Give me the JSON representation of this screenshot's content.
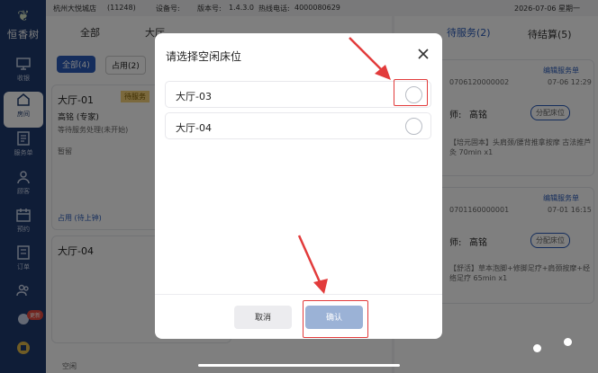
{
  "app": {
    "logo_text": "恒香树"
  },
  "statusbar": {
    "store": "杭州大悦城店",
    "store_code": "(11248)",
    "device_label": "设备号:",
    "version_label": "版本号:",
    "version": "1.4.3.0",
    "phone_label": "热线电话:",
    "phone": "4000080629",
    "date": "2026-07-06 星期一"
  },
  "sidebar": {
    "items": [
      {
        "label": "收银"
      },
      {
        "label": "房间"
      },
      {
        "label": "服务单"
      },
      {
        "label": "顾客"
      },
      {
        "label": "预约"
      },
      {
        "label": "订单"
      },
      {
        "label": ""
      },
      {
        "label": ""
      }
    ],
    "badge": "更新"
  },
  "background": {
    "tabs": [
      "全部",
      "大厅"
    ],
    "filters": [
      "全部(4)",
      "占用(2)"
    ],
    "room1": {
      "name": "大厅-01",
      "tag": "待服务",
      "tech": "高铭 (专家)",
      "note": "等待服务处理(未开始)",
      "status": "占用 (待上钟)",
      "extra": "暂留"
    },
    "room2": {
      "name": "大厅-04"
    },
    "idle_label": "空闲",
    "right_tabs": [
      "待服务(2)",
      "待结算(5)"
    ],
    "orders": [
      {
        "no": "0706120000002",
        "time": "07-06 12:29",
        "link": "编辑服务单",
        "tech_prefix": "师:",
        "tech": "高铭",
        "action": "分配床位",
        "desc": "【培元固本】头肩颈/腰背推拿按摩 古法推芦灸 70min x1"
      },
      {
        "no": "0701160000001",
        "time": "07-01 16:15",
        "link": "编辑服务单",
        "tech_prefix": "师:",
        "tech": "高铭",
        "action": "分配床位",
        "desc": "【舒活】草本泡脚+修脚足疗+肩颈按摩+经络足疗 65min x1"
      }
    ]
  },
  "modal": {
    "title": "请选择空闲床位",
    "options": [
      {
        "label": "大厅-03",
        "selected": false
      },
      {
        "label": "大厅-04",
        "selected": false
      }
    ],
    "cancel_label": "取消",
    "confirm_label": "确认"
  },
  "colors": {
    "sidebar": "#1e3a6e",
    "confirm_disabled": "#9bb2d6",
    "annotation": "#e23b3b"
  }
}
